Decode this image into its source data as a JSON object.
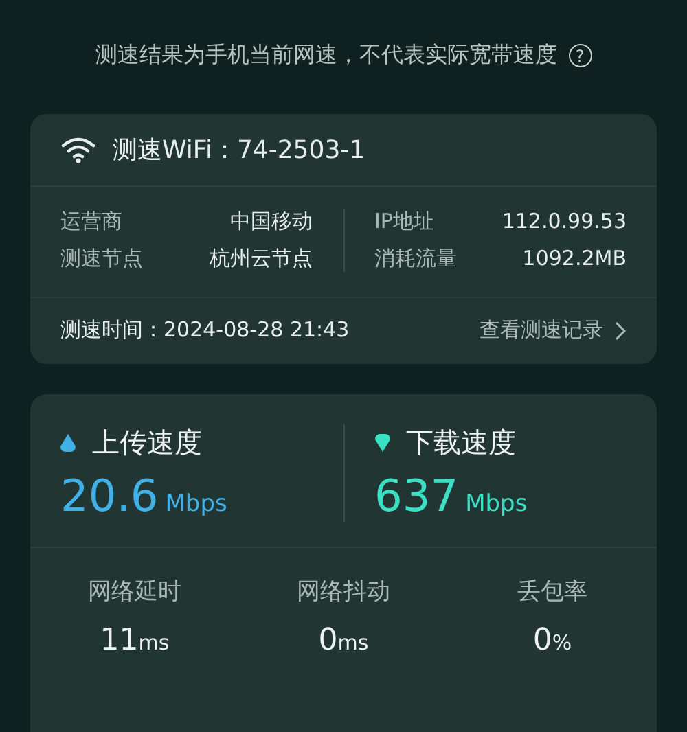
{
  "notice": {
    "text": "测速结果为手机当前网速，不代表实际宽带速度",
    "help": "?"
  },
  "info_card": {
    "title": "测速WiFi：74-2503-1",
    "left": [
      {
        "label": "运营商",
        "value": "中国移动"
      },
      {
        "label": "测速节点",
        "value": "杭州云节点"
      }
    ],
    "right": [
      {
        "label": "IP地址",
        "value": "112.0.99.53"
      },
      {
        "label": "消耗流量",
        "value": "1092.2MB"
      }
    ],
    "time": "测速时间：2024-08-28 21:43",
    "history_link": "查看测速记录"
  },
  "speeds": [
    {
      "kind": "upload",
      "label": "上传速度",
      "value": "20.6",
      "unit": "Mbps",
      "color": "#3fb1e6"
    },
    {
      "kind": "download",
      "label": "下载速度",
      "value": "637",
      "unit": "Mbps",
      "color": "#3be0c4"
    }
  ],
  "metrics": [
    {
      "label": "网络延时",
      "value": "11",
      "unit": "ms"
    },
    {
      "label": "网络抖动",
      "value": "0",
      "unit": "ms"
    },
    {
      "label": "丢包率",
      "value": "0",
      "unit": "%"
    }
  ]
}
